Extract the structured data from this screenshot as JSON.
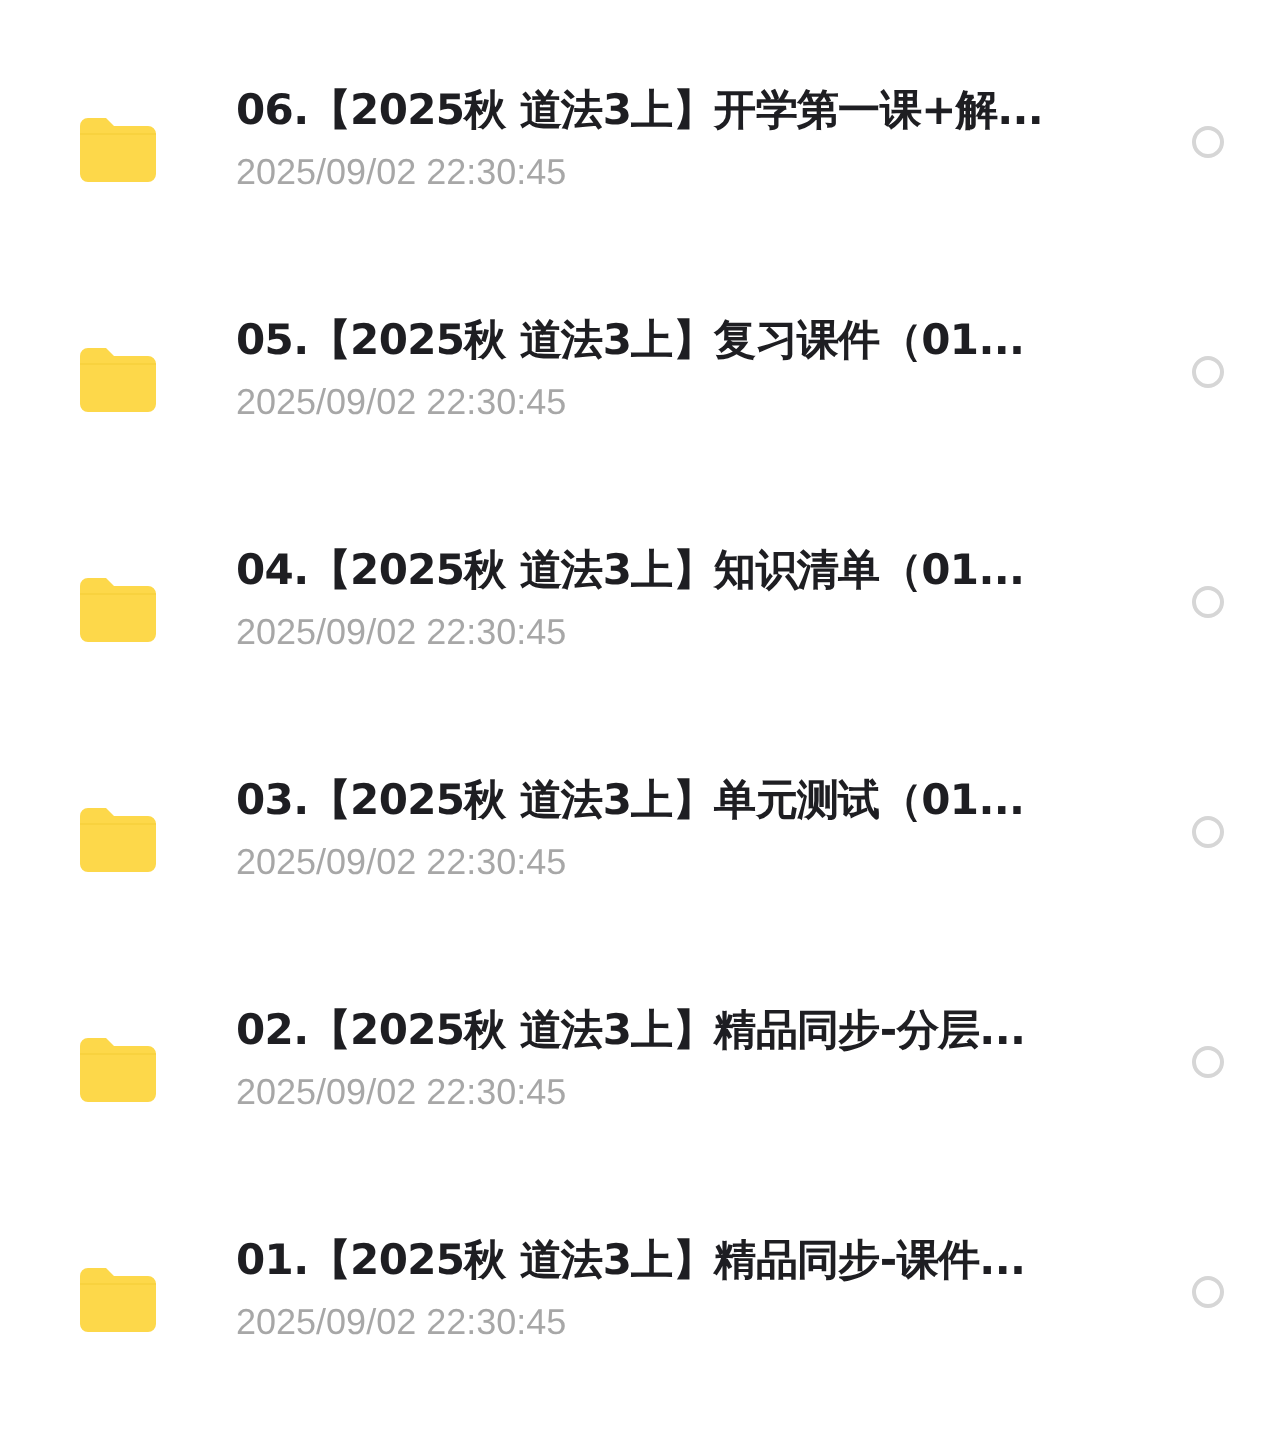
{
  "files": [
    {
      "name": "06.【2025秋 道法3上】开学第一课+解...",
      "date": "2025/09/02 22:30:45",
      "selected": false
    },
    {
      "name": "05.【2025秋 道法3上】复习课件（01...",
      "date": "2025/09/02 22:30:45",
      "selected": false
    },
    {
      "name": "04.【2025秋 道法3上】知识清单（01...",
      "date": "2025/09/02 22:30:45",
      "selected": false
    },
    {
      "name": "03.【2025秋 道法3上】单元测试（01...",
      "date": "2025/09/02 22:30:45",
      "selected": false
    },
    {
      "name": "02.【2025秋 道法3上】精品同步-分层...",
      "date": "2025/09/02 22:30:45",
      "selected": false
    },
    {
      "name": "01.【2025秋 道法3上】精品同步-课件...",
      "date": "2025/09/02 22:30:45",
      "selected": false
    }
  ]
}
